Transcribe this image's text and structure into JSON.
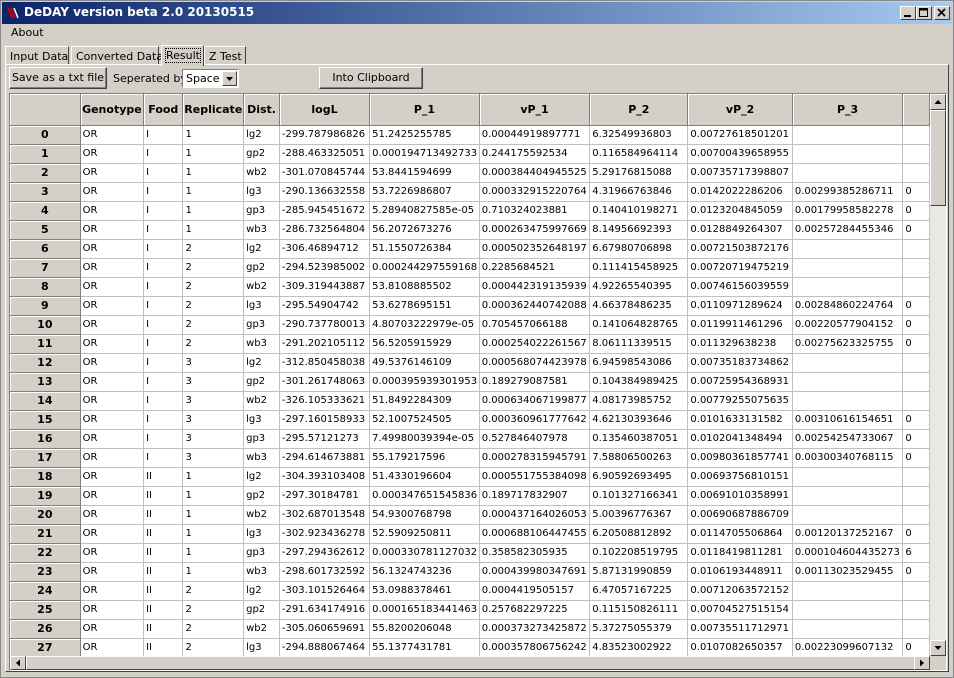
{
  "window": {
    "title": "DeDAY version beta 2.0 20130515"
  },
  "menu": {
    "items": [
      "About"
    ]
  },
  "tabs": [
    "Input Data",
    "Converted Data",
    "Result",
    "Z Test"
  ],
  "toolbar": {
    "save_label": "Save as a txt file",
    "separated_label": "Seperated by",
    "separator_value": "Space",
    "clipboard_label": "Into Clipboard"
  },
  "table": {
    "columns": [
      "",
      "Genotype",
      "Food",
      "Replicate",
      "Dist.",
      "logL",
      "P_1",
      "vP_1",
      "P_2",
      "vP_2",
      "P_3",
      ""
    ],
    "rows": [
      [
        "0",
        "OR",
        "I",
        "1",
        "lg2",
        "-299.787986826",
        "51.2425255785",
        "0.00044919897771",
        "6.32549936803",
        "0.00727618501201",
        "",
        ""
      ],
      [
        "1",
        "OR",
        "I",
        "1",
        "gp2",
        "-288.463325051",
        "0.000194713492733",
        "0.244175592534",
        "0.116584964114",
        "0.00700439658955",
        "",
        ""
      ],
      [
        "2",
        "OR",
        "I",
        "1",
        "wb2",
        "-301.070845744",
        "53.8441594699",
        "0.000384404945525",
        "5.29176815088",
        "0.00735717398807",
        "",
        ""
      ],
      [
        "3",
        "OR",
        "I",
        "1",
        "lg3",
        "-290.136632558",
        "53.7226986807",
        "0.000332915220764",
        "4.31966763846",
        "0.0142022286206",
        "0.00299385286711",
        "0"
      ],
      [
        "4",
        "OR",
        "I",
        "1",
        "gp3",
        "-285.945451672",
        "5.28940827585e-05",
        "0.710324023881",
        "0.140410198271",
        "0.0123204845059",
        "0.00179958582278",
        "0"
      ],
      [
        "5",
        "OR",
        "I",
        "1",
        "wb3",
        "-286.732564804",
        "56.2072673276",
        "0.000263475997669",
        "8.14956692393",
        "0.0128849264307",
        "0.00257284455346",
        "0"
      ],
      [
        "6",
        "OR",
        "I",
        "2",
        "lg2",
        "-306.46894712",
        "51.1550726384",
        "0.000502352648197",
        "6.67980706898",
        "0.00721503872176",
        "",
        ""
      ],
      [
        "7",
        "OR",
        "I",
        "2",
        "gp2",
        "-294.523985002",
        "0.000244297559168",
        "0.2285684521",
        "0.111415458925",
        "0.00720719475219",
        "",
        ""
      ],
      [
        "8",
        "OR",
        "I",
        "2",
        "wb2",
        "-309.319443887",
        "53.8108885502",
        "0.000442319135939",
        "4.92265540395",
        "0.00746156039559",
        "",
        ""
      ],
      [
        "9",
        "OR",
        "I",
        "2",
        "lg3",
        "-295.54904742",
        "53.6278695151",
        "0.000362440742088",
        "4.66378486235",
        "0.0110971289624",
        "0.00284860224764",
        "0"
      ],
      [
        "10",
        "OR",
        "I",
        "2",
        "gp3",
        "-290.737780013",
        "4.80703222979e-05",
        "0.705457066188",
        "0.141064828765",
        "0.0119911461296",
        "0.00220577904152",
        "0"
      ],
      [
        "11",
        "OR",
        "I",
        "2",
        "wb3",
        "-291.202105112",
        "56.5205915929",
        "0.000254022261567",
        "8.06111339515",
        "0.01132963823​8",
        "0.00275623325755",
        "0"
      ],
      [
        "12",
        "OR",
        "I",
        "3",
        "lg2",
        "-312.850458038",
        "49.5376146109",
        "0.000568074423978",
        "6.94598543086",
        "0.00735183734862",
        "",
        ""
      ],
      [
        "13",
        "OR",
        "I",
        "3",
        "gp2",
        "-301.261748063",
        "0.000395939301953",
        "0.189279087581",
        "0.104384989425",
        "0.00725954368931",
        "",
        ""
      ],
      [
        "14",
        "OR",
        "I",
        "3",
        "wb2",
        "-326.105333621",
        "51.8492284309",
        "0.000634067199877",
        "4.08173985752",
        "0.00779255075635",
        "",
        ""
      ],
      [
        "15",
        "OR",
        "I",
        "3",
        "lg3",
        "-297.160158933",
        "52.1007524505",
        "0.000360961777642",
        "4.62130393646",
        "0.0101633131582",
        "0.00310616154651",
        "0"
      ],
      [
        "16",
        "OR",
        "I",
        "3",
        "gp3",
        "-295.57121273",
        "7.49980039394e-05",
        "0.527846407978",
        "0.135460387051",
        "0.0102041348494",
        "0.00254254733067",
        "0"
      ],
      [
        "17",
        "OR",
        "I",
        "3",
        "wb3",
        "-294.614673881",
        "55.179217596",
        "0.000278315945791",
        "7.58806500263",
        "0.00980361857741",
        "0.00300340768115",
        "0"
      ],
      [
        "18",
        "OR",
        "II",
        "1",
        "lg2",
        "-304.393103408",
        "51.4330196604",
        "0.000551755384098",
        "6.90592693495",
        "0.00693756810151",
        "",
        ""
      ],
      [
        "19",
        "OR",
        "II",
        "1",
        "gp2",
        "-297.30184781",
        "0.000347651545836",
        "0.189717832907",
        "0.101327166341",
        "0.00691010358991",
        "",
        ""
      ],
      [
        "20",
        "OR",
        "II",
        "1",
        "wb2",
        "-302.687013548",
        "54.9300768798",
        "0.000437164026053",
        "5.00396776367",
        "0.00690687886709",
        "",
        ""
      ],
      [
        "21",
        "OR",
        "II",
        "1",
        "lg3",
        "-302.923436278",
        "52.5909250811",
        "0.000688106447455",
        "6.20508812892",
        "0.0114705506864",
        "0.00120137252167",
        "0"
      ],
      [
        "22",
        "OR",
        "II",
        "1",
        "gp3",
        "-297.294362612",
        "0.000330781127032",
        "0.358582305935",
        "0.102208519795",
        "0.0118419811281",
        "0.000104604435273",
        "6"
      ],
      [
        "23",
        "OR",
        "II",
        "1",
        "wb3",
        "-298.601732592",
        "56.1324743236",
        "0.000439980347691",
        "5.87131990859",
        "0.0106193448911",
        "0.00113023529455",
        "0"
      ],
      [
        "24",
        "OR",
        "II",
        "2",
        "lg2",
        "-303.101526464",
        "53.0988378461",
        "0.000441950515​7",
        "6.47057167225",
        "0.00712063572152",
        "",
        ""
      ],
      [
        "25",
        "OR",
        "II",
        "2",
        "gp2",
        "-291.634174916",
        "0.000165183441463",
        "0.257682297225",
        "0.115150826111",
        "0.00704527515154",
        "",
        ""
      ],
      [
        "26",
        "OR",
        "II",
        "2",
        "wb2",
        "-305.060659691",
        "55.8200206048",
        "0.000373273425872",
        "5.37275055379",
        "0.00735511712971",
        "",
        ""
      ],
      [
        "27",
        "OR",
        "II",
        "2",
        "lg3",
        "-294.888067464",
        "55.1377431781",
        "0.000357806756242",
        "4.83523002922",
        "0.0107082650357",
        "0.00223099607132",
        "0"
      ]
    ]
  }
}
